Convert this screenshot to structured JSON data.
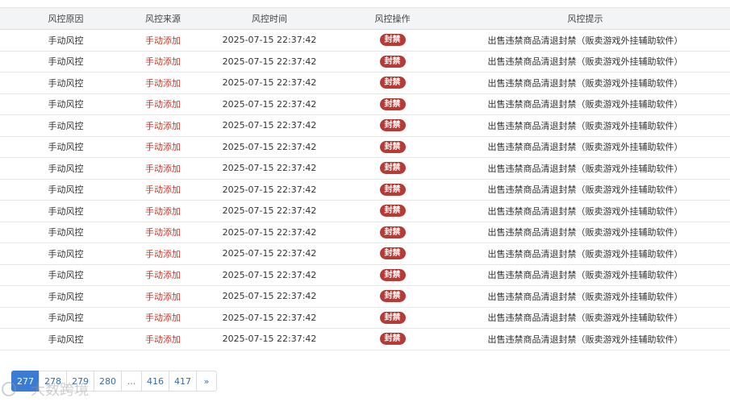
{
  "table": {
    "headers": [
      "风控原因",
      "风控来源",
      "风控时间",
      "风控操作",
      "风控提示"
    ],
    "rows": [
      {
        "reason": "手动风控",
        "source": "手动添加",
        "time": "2025-07-15 22:37:42",
        "action": "封禁",
        "tip": "出售违禁商品清退封禁（贩卖游戏外挂辅助软件）"
      },
      {
        "reason": "手动风控",
        "source": "手动添加",
        "time": "2025-07-15 22:37:42",
        "action": "封禁",
        "tip": "出售违禁商品清退封禁（贩卖游戏外挂辅助软件）"
      },
      {
        "reason": "手动风控",
        "source": "手动添加",
        "time": "2025-07-15 22:37:42",
        "action": "封禁",
        "tip": "出售违禁商品清退封禁（贩卖游戏外挂辅助软件）"
      },
      {
        "reason": "手动风控",
        "source": "手动添加",
        "time": "2025-07-15 22:37:42",
        "action": "封禁",
        "tip": "出售违禁商品清退封禁（贩卖游戏外挂辅助软件）"
      },
      {
        "reason": "手动风控",
        "source": "手动添加",
        "time": "2025-07-15 22:37:42",
        "action": "封禁",
        "tip": "出售违禁商品清退封禁（贩卖游戏外挂辅助软件）"
      },
      {
        "reason": "手动风控",
        "source": "手动添加",
        "time": "2025-07-15 22:37:42",
        "action": "封禁",
        "tip": "出售违禁商品清退封禁（贩卖游戏外挂辅助软件）"
      },
      {
        "reason": "手动风控",
        "source": "手动添加",
        "time": "2025-07-15 22:37:42",
        "action": "封禁",
        "tip": "出售违禁商品清退封禁（贩卖游戏外挂辅助软件）"
      },
      {
        "reason": "手动风控",
        "source": "手动添加",
        "time": "2025-07-15 22:37:42",
        "action": "封禁",
        "tip": "出售违禁商品清退封禁（贩卖游戏外挂辅助软件）"
      },
      {
        "reason": "手动风控",
        "source": "手动添加",
        "time": "2025-07-15 22:37:42",
        "action": "封禁",
        "tip": "出售违禁商品清退封禁（贩卖游戏外挂辅助软件）"
      },
      {
        "reason": "手动风控",
        "source": "手动添加",
        "time": "2025-07-15 22:37:42",
        "action": "封禁",
        "tip": "出售违禁商品清退封禁（贩卖游戏外挂辅助软件）"
      },
      {
        "reason": "手动风控",
        "source": "手动添加",
        "time": "2025-07-15 22:37:42",
        "action": "封禁",
        "tip": "出售违禁商品清退封禁（贩卖游戏外挂辅助软件）"
      },
      {
        "reason": "手动风控",
        "source": "手动添加",
        "time": "2025-07-15 22:37:42",
        "action": "封禁",
        "tip": "出售违禁商品清退封禁（贩卖游戏外挂辅助软件）"
      },
      {
        "reason": "手动风控",
        "source": "手动添加",
        "time": "2025-07-15 22:37:42",
        "action": "封禁",
        "tip": "出售违禁商品清退封禁（贩卖游戏外挂辅助软件）"
      },
      {
        "reason": "手动风控",
        "source": "手动添加",
        "time": "2025-07-15 22:37:42",
        "action": "封禁",
        "tip": "出售违禁商品清退封禁（贩卖游戏外挂辅助软件）"
      },
      {
        "reason": "手动风控",
        "source": "手动添加",
        "time": "2025-07-15 22:37:42",
        "action": "封禁",
        "tip": "出售违禁商品清退封禁（贩卖游戏外挂辅助软件）"
      }
    ]
  },
  "pagination": {
    "items": [
      {
        "label": "277",
        "active": true
      },
      {
        "label": "278",
        "active": false
      },
      {
        "label": "279",
        "active": false
      },
      {
        "label": "280",
        "active": false
      },
      {
        "label": "...",
        "active": false,
        "gap": true
      },
      {
        "label": "416",
        "active": false
      },
      {
        "label": "417",
        "active": false
      },
      {
        "label": "»",
        "active": false
      }
    ]
  },
  "colors": {
    "source_text": "#c0392b",
    "badge_bg": "#b63a36",
    "active_page": "#3a7bd5",
    "header_bg": "#f3f4f6"
  },
  "watermark": {
    "text": "大数跨境"
  }
}
